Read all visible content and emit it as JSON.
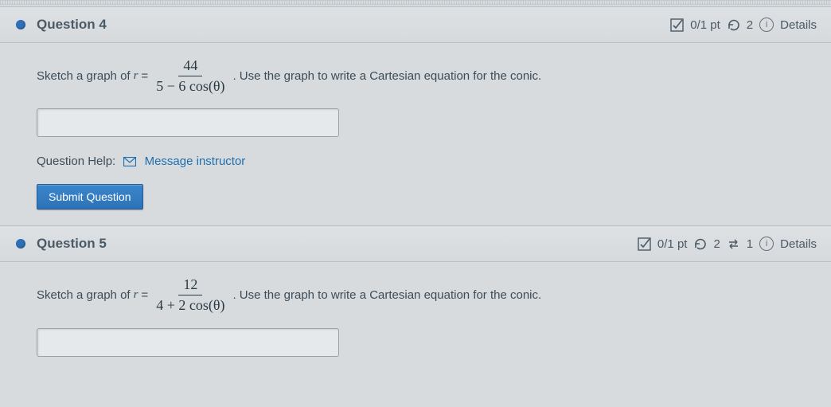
{
  "q4": {
    "title": "Question 4",
    "score_text": "0/1 pt",
    "attempts_text": "2",
    "details_label": "Details",
    "prompt_before": "Sketch a graph of ",
    "var": "r",
    "equals": " = ",
    "numerator": "44",
    "denominator": "5 − 6 cos(θ)",
    "prompt_after": ". Use the graph to write a Cartesian equation for the conic.",
    "help_label": "Question Help:",
    "help_link": "Message instructor",
    "submit_label": "Submit Question"
  },
  "q5": {
    "title": "Question 5",
    "score_text": "0/1 pt",
    "attempts_text": "2",
    "retries_text": "1",
    "details_label": "Details",
    "prompt_before": "Sketch a graph of ",
    "var": "r",
    "equals": " = ",
    "numerator": "12",
    "denominator": "4 + 2 cos(θ)",
    "prompt_after": ". Use the graph to write a Cartesian equation for the conic."
  }
}
